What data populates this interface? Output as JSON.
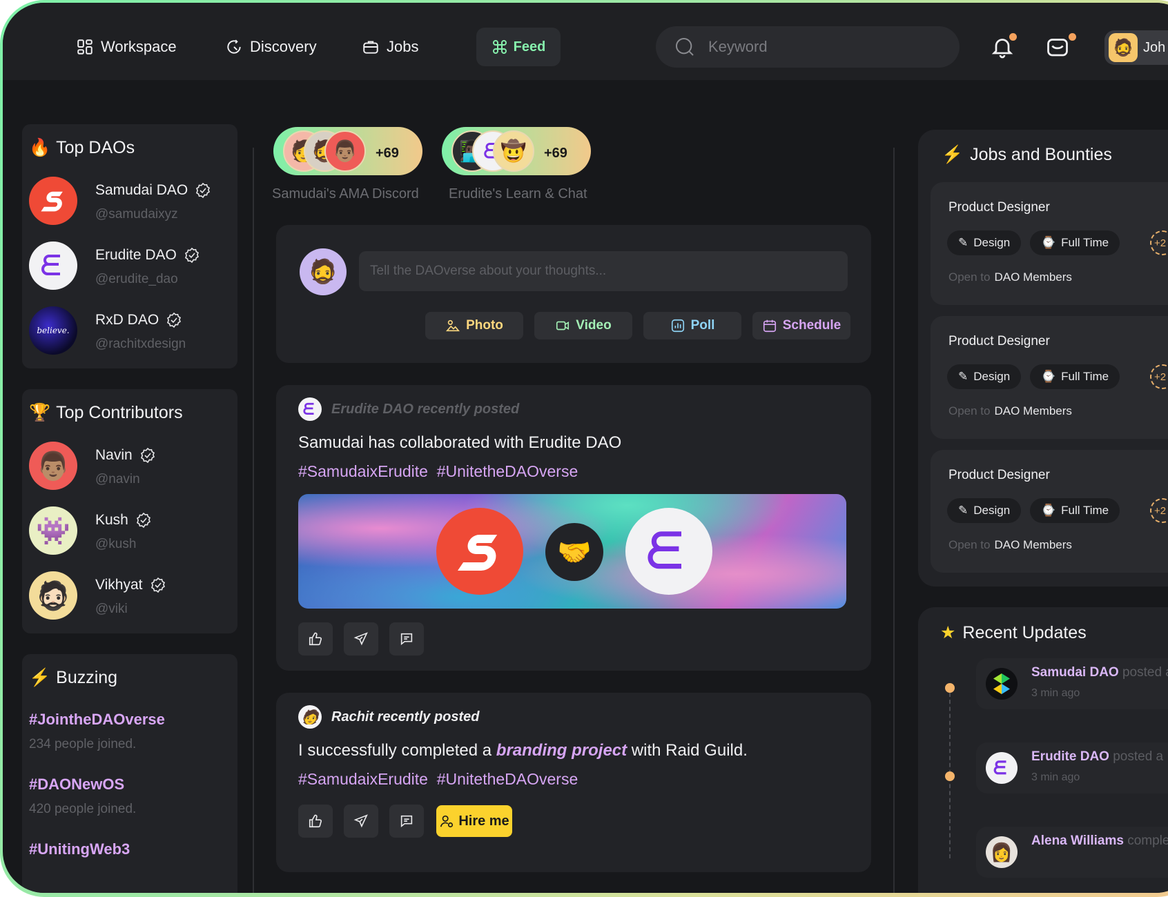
{
  "nav": {
    "workspace": "Workspace",
    "discovery": "Discovery",
    "jobs": "Jobs",
    "feed": "Feed",
    "search_placeholder": "Keyword",
    "profile_name": "Joh"
  },
  "colors": {
    "accent_green": "#86efac",
    "accent_purple": "#d6a5f3",
    "notif_dot": "#f5a25d",
    "hire_yellow": "#fbd22d"
  },
  "top_daos": {
    "title": "Top DAOs",
    "items": [
      {
        "name": "Samudai DAO",
        "handle": "@samudaixyz"
      },
      {
        "name": "Erudite DAO",
        "handle": "@erudite_dao"
      },
      {
        "name": "RxD DAO",
        "handle": "@rachitxdesign",
        "logo_text": "believe."
      }
    ]
  },
  "top_contributors": {
    "title": "Top Contributors",
    "items": [
      {
        "name": "Navin",
        "handle": "@navin"
      },
      {
        "name": "Kush",
        "handle": "@kush"
      },
      {
        "name": "Vikhyat",
        "handle": "@viki"
      }
    ]
  },
  "buzzing": {
    "title": "Buzzing",
    "items": [
      {
        "tag": "#JointheDAOverse",
        "sub": "234 people joined."
      },
      {
        "tag": "#DAONewOS",
        "sub": "420 people joined."
      },
      {
        "tag": "#UnitingWeb3",
        "sub": ""
      }
    ]
  },
  "groups": [
    {
      "label": "Samudai's AMA Discord",
      "count": "+69"
    },
    {
      "label": "Erudite's Learn & Chat",
      "count": "+69"
    }
  ],
  "composer": {
    "placeholder": "Tell the DAOverse about your thoughts...",
    "photo": "Photo",
    "video": "Video",
    "poll": "Poll",
    "schedule": "Schedule"
  },
  "posts": [
    {
      "header": "Erudite DAO recently posted",
      "text": "Samudai has collaborated with Erudite DAO",
      "hashtags": "#SamudaixErudite  #UnitetheDAOverse"
    },
    {
      "header": "Rachit recently posted",
      "text_before": "I successfully completed a ",
      "text_emph": "branding project",
      "text_after": " with Raid Guild.",
      "hashtags": "#SamudaixErudite  #UnitetheDAOverse",
      "hire": "Hire me"
    }
  ],
  "jobs": {
    "title": "Jobs and Bounties",
    "items": [
      {
        "title": "Product Designer",
        "tag1": "Design",
        "tag2": "Full Time",
        "more": "+2",
        "open_label": "Open to",
        "open_value": "DAO Members"
      },
      {
        "title": "Product Designer",
        "tag1": "Design",
        "tag2": "Full Time",
        "more": "+2",
        "open_label": "Open to",
        "open_value": "DAO Members"
      },
      {
        "title": "Product Designer",
        "tag1": "Design",
        "tag2": "Full Time",
        "more": "+2",
        "open_label": "Open to",
        "open_value": "DAO Members"
      }
    ]
  },
  "updates": {
    "title": "Recent Updates",
    "items": [
      {
        "name": "Samudai DAO",
        "action": " posted a",
        "time": "3 min ago"
      },
      {
        "name": "Erudite DAO",
        "action": " posted a",
        "time": "3 min ago"
      },
      {
        "name": "Alena Williams",
        "action": " comple",
        "time": ""
      }
    ]
  }
}
